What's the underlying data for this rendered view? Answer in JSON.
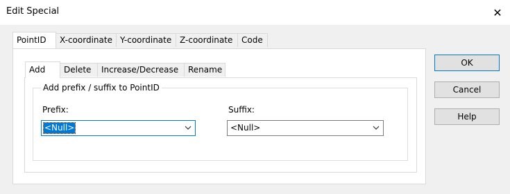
{
  "window": {
    "title": "Edit Special",
    "close_glyph": "✕"
  },
  "outer_tabs": [
    "PointID",
    "X-coordinate",
    "Y-coordinate",
    "Z-coordinate",
    "Code"
  ],
  "outer_active_tab": "PointID",
  "inner_tabs": [
    "Add",
    "Delete",
    "Increase/Decrease",
    "Rename"
  ],
  "inner_active_tab": "Add",
  "group": {
    "legend": "Add prefix / suffix to PointID",
    "prefix": {
      "label": "Prefix:",
      "value": "<Null>"
    },
    "suffix": {
      "label": "Suffix:",
      "value": "<Null>"
    }
  },
  "buttons": {
    "ok": "OK",
    "cancel": "Cancel",
    "help": "Help"
  },
  "colors": {
    "accent": "#0078d7",
    "dialog_bg": "#f0f0f0",
    "panel_bg": "#ffffff"
  },
  "icons": {
    "close": "close-icon",
    "dropdown": "chevron-down-icon"
  }
}
